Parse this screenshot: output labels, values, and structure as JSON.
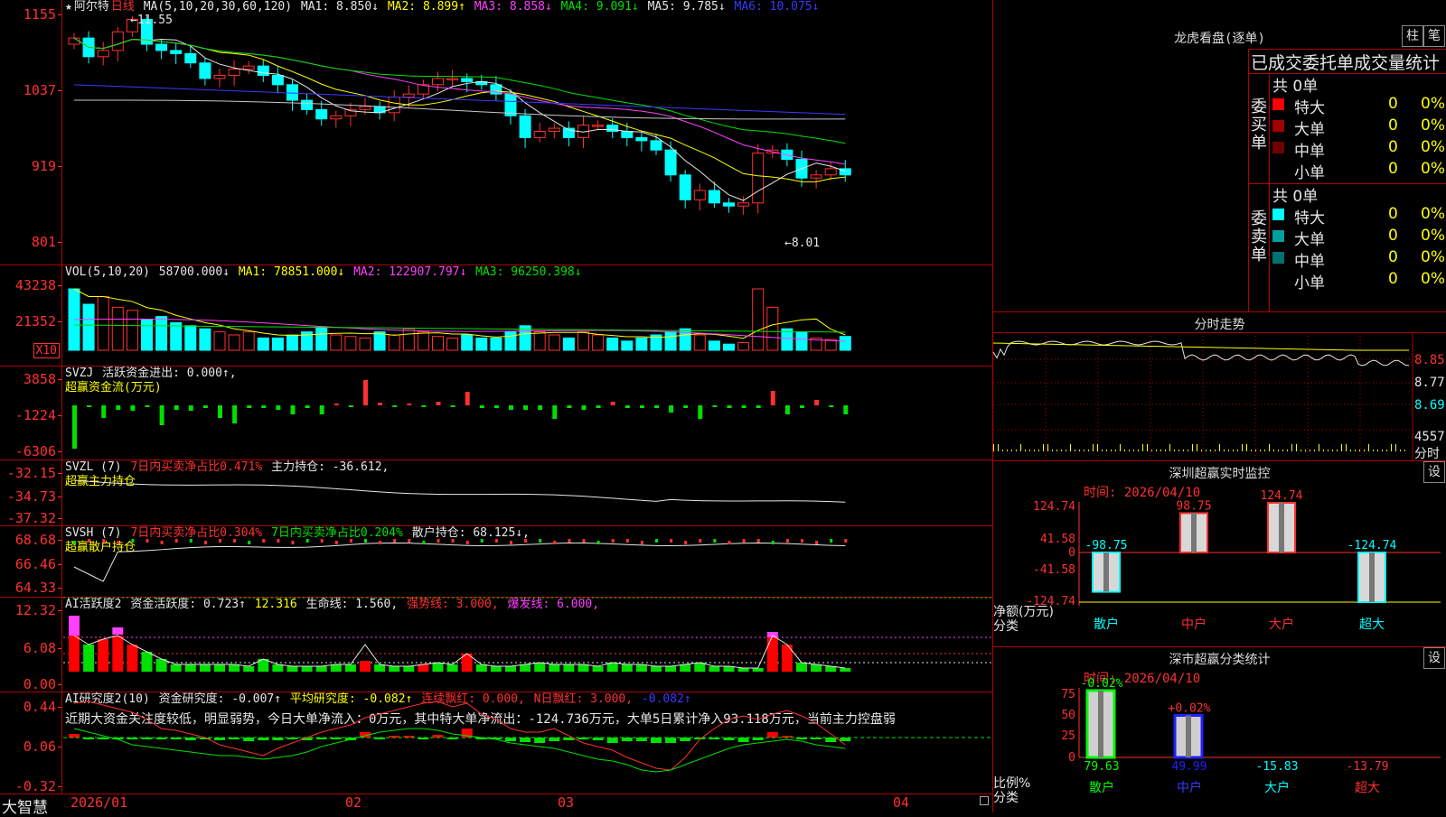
{
  "app": {
    "brand": "大智慧",
    "stock_name": "阿尔特",
    "period": "日线",
    "star": "★"
  },
  "main": {
    "ma_title": "MA(5,10,20,30,60,120)",
    "ma1": "MA1: 8.850↓",
    "ma2": "MA2: 8.899↑",
    "ma3": "MA3: 8.858↓",
    "ma4": "MA4: 9.091↓",
    "ma5": "MA5: 9.785↓",
    "ma6": "MA6: 10.075↓",
    "high_mark": "11.55",
    "low_mark": "8.01",
    "y_labels": [
      "1155",
      "1037",
      "919",
      "801"
    ]
  },
  "vol": {
    "title": "VOL(5,10,20)",
    "value": "58700.000↓",
    "ma1": "MA1: 78851.000↓",
    "ma2": "MA2: 122907.797↓",
    "ma3": "MA3: 96250.398↓",
    "y_labels": [
      "43238",
      "21352"
    ],
    "unit": "X10"
  },
  "svzj": {
    "title": "SVZJ",
    "label1": "活跃资金进出: 0.000↑,",
    "label2": "超赢资金流(万元)",
    "y_labels": [
      "3858",
      "-1224",
      "-6306"
    ]
  },
  "svzl": {
    "title": "SVZL (7)",
    "label1": "7日内买卖净占比0.471%",
    "label2": "主力持仓: -36.612,",
    "label3": "超赢主力持仓",
    "y_labels": [
      "-32.15",
      "-34.73",
      "-37.32"
    ]
  },
  "svsh": {
    "title": "SVSH (7)",
    "label1": "7日内买卖净占比0.304%",
    "label2": "7日内买卖净占比0.204%",
    "label3": "散户持仓: 68.125↓,",
    "label4": "超赢散户持仓",
    "y_labels": [
      "68.68",
      "66.46",
      "64.33"
    ]
  },
  "ai1": {
    "title": "AI活跃度2",
    "l1": "资金活跃度: 0.723↑",
    "l2": "12.316",
    "l3": "生命线: 1.560,",
    "l4": "强势线: 3.000,",
    "l5": "爆发线: 6.000,",
    "y_labels": [
      "12.32",
      "6.08",
      "0.00"
    ]
  },
  "ai2": {
    "title": "AI研究度2(10)",
    "l1": "资金研究度: -0.007↑",
    "l2": "平均研究度: -0.082↑",
    "l3": "连续飘红: 0.000,",
    "l4": "N日飘红: 3.000,",
    "l5": "-0.082↑",
    "note": "近期大资金关注度较低，明显弱势，今日大单净流入：0万元，其中特大单净流出：-124.736万元，大单5日累计净入93.118万元，当前主力控盘弱",
    "y_labels": [
      "0.44",
      "0.06",
      "-0.32"
    ]
  },
  "xaxis": [
    "2026/01",
    "02",
    "03",
    "04"
  ],
  "dragon": {
    "title": "龙虎看盘(逐单)",
    "btn1": "柱",
    "btn2": "笔",
    "header": "已成交委托单成交量统计",
    "buy_side": "委买单",
    "sell_side": "委卖单",
    "buy_total": "共 0单",
    "sell_total": "共 0单",
    "buy_rows": [
      {
        "label": "特大",
        "count": "0",
        "pct": "0%",
        "color": "#ff0000"
      },
      {
        "label": "大单",
        "count": "0",
        "pct": "0%",
        "color": "#a00000"
      },
      {
        "label": "中单",
        "count": "0",
        "pct": "0%",
        "color": "#700000"
      },
      {
        "label": "小单",
        "count": "0",
        "pct": "0%",
        "color": "#000000"
      }
    ],
    "sell_rows": [
      {
        "label": "特大",
        "count": "0",
        "pct": "0%",
        "color": "#00ffff"
      },
      {
        "label": "大单",
        "count": "0",
        "pct": "0%",
        "color": "#00a0a0"
      },
      {
        "label": "中单",
        "count": "0",
        "pct": "0%",
        "color": "#007070"
      },
      {
        "label": "小单",
        "count": "0",
        "pct": "0%",
        "color": "#000000"
      }
    ]
  },
  "timeshare": {
    "title": "分时走势",
    "y_labels": [
      "8.85",
      "8.77",
      "8.69"
    ],
    "vol_label": "4557",
    "vol_unit": "分时"
  },
  "monitor": {
    "title": "深圳超赢实时监控",
    "btn": "设",
    "time": "时间: 2026/04/10",
    "y_labels": [
      "124.74",
      "41.58",
      "0",
      "-41.58",
      "-124.74"
    ],
    "unit1": "净额(万元)",
    "unit2": "分类",
    "categories": [
      "散户",
      "中户",
      "大户",
      "超大"
    ],
    "values": [
      -98.75,
      98.75,
      124.74,
      -124.74
    ],
    "value_labels": [
      "-98.75",
      "98.75",
      "124.74",
      "-124.74"
    ]
  },
  "classify": {
    "title": "深市超赢分类统计",
    "btn": "设",
    "time": "时间: 2026/04/10",
    "y_labels": [
      "75",
      "50",
      "25",
      "0"
    ],
    "unit1": "比例%",
    "unit2": "分类",
    "categories": [
      "散户",
      "中户",
      "大户",
      "超大"
    ],
    "values": [
      79.63,
      49.99,
      15.83,
      13.79
    ],
    "bottom_labels": [
      "79.63",
      "49.99",
      "-15.83",
      "-13.79"
    ],
    "top_labels": [
      "-0.02%",
      "+0.02%"
    ]
  },
  "chart_data": [
    {
      "type": "candlestick",
      "title": "阿尔特 日线",
      "ylim": [
        8.01,
        11.55
      ],
      "close": [
        11.2,
        10.9,
        11.0,
        11.3,
        11.5,
        11.1,
        11.0,
        10.95,
        10.8,
        10.55,
        10.6,
        10.7,
        10.75,
        10.6,
        10.45,
        10.2,
        10.05,
        9.9,
        9.95,
        10.05,
        10.1,
        10.0,
        10.25,
        10.3,
        10.45,
        10.55,
        10.55,
        10.5,
        10.45,
        10.3,
        9.95,
        9.6,
        9.7,
        9.75,
        9.6,
        9.8,
        9.8,
        9.7,
        9.6,
        9.55,
        9.4,
        9.0,
        8.6,
        8.75,
        8.55,
        8.5,
        8.55,
        9.35,
        9.4,
        9.25,
        8.95,
        9.0,
        9.1,
        9.0
      ]
    },
    {
      "type": "bar",
      "title": "VOL(5,10,20)",
      "ylim": [
        0,
        43238
      ]
    },
    {
      "type": "bar",
      "title": "深圳超赢实时监控",
      "categories": [
        "散户",
        "中户",
        "大户",
        "超大"
      ],
      "values": [
        -98.75,
        98.75,
        124.74,
        -124.74
      ]
    },
    {
      "type": "bar",
      "title": "深市超赢分类统计",
      "categories": [
        "散户",
        "中户",
        "大户",
        "超大"
      ],
      "values": [
        79.63,
        49.99,
        15.83,
        13.79
      ]
    }
  ]
}
